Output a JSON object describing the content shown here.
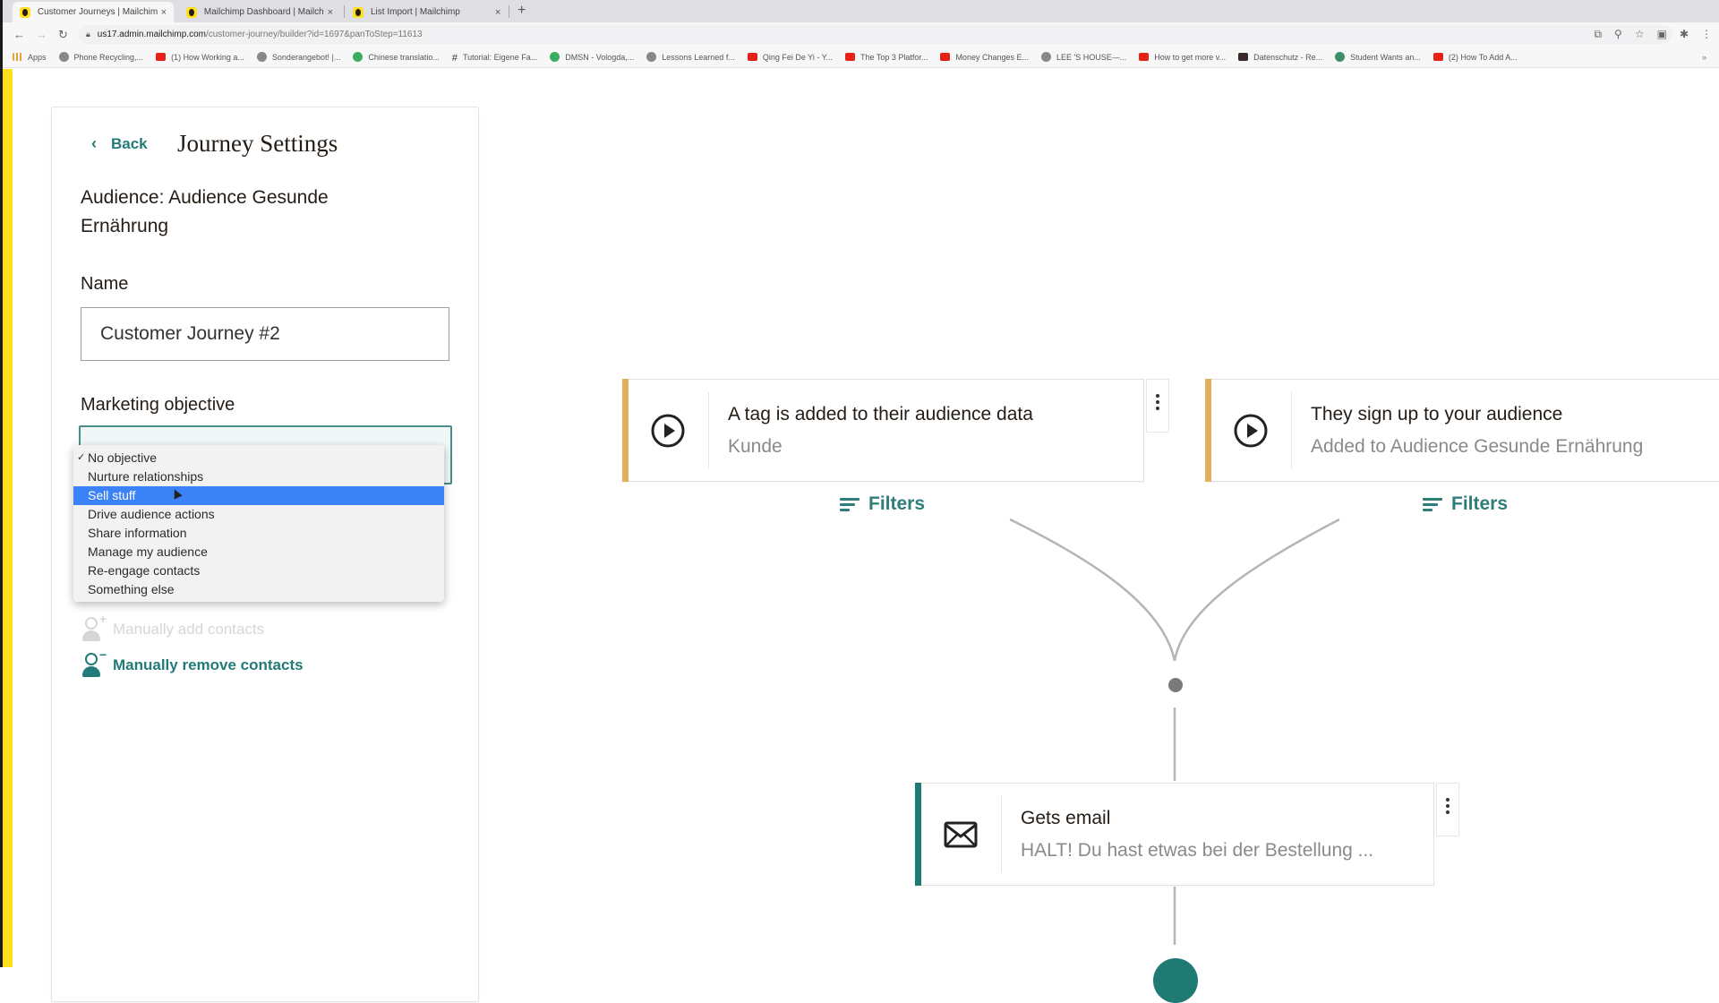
{
  "browser": {
    "tabs": [
      {
        "title": "Customer Journeys | Mailchimp",
        "active": true
      },
      {
        "title": "Mailchimp Dashboard | Mailchimp",
        "active": false
      },
      {
        "title": "List Import | Mailchimp",
        "active": false
      }
    ],
    "close_glyph": "×",
    "new_tab_glyph": "+",
    "url_host": "us17.admin.mailchimp.com",
    "url_path": "/customer-journey/builder?id=1697&panToStep=11613",
    "bookmarks": [
      {
        "label": "Apps",
        "icon": "apps-grid-icon"
      },
      {
        "label": "Phone Recycling,...",
        "icon": "o-icon"
      },
      {
        "label": "(1) How Working a...",
        "icon": "youtube-icon"
      },
      {
        "label": "Sonderangebot! |...",
        "icon": "globe-icon"
      },
      {
        "label": "Chinese translatio...",
        "icon": "green-circle-icon"
      },
      {
        "label": "Tutorial: Eigene Fa...",
        "icon": "hash-icon"
      },
      {
        "label": "DMSN - Vologda,...",
        "icon": "green-circle-icon"
      },
      {
        "label": "Lessons Learned f...",
        "icon": "figure-icon"
      },
      {
        "label": "Qing Fei De Yi - Y...",
        "icon": "youtube-icon"
      },
      {
        "label": "The Top 3 Platfor...",
        "icon": "youtube-icon"
      },
      {
        "label": "Money Changes E...",
        "icon": "youtube-icon"
      },
      {
        "label": "LEE 'S HOUSE—...",
        "icon": "airbnb-icon"
      },
      {
        "label": "How to get more v...",
        "icon": "youtube-icon"
      },
      {
        "label": "Datenschutz - Re...",
        "icon": "dark-square-icon"
      },
      {
        "label": "Student Wants an...",
        "icon": "teal-circle-icon"
      },
      {
        "label": "(2) How To Add A...",
        "icon": "youtube-icon"
      }
    ],
    "bookmarks_overflow": "»"
  },
  "panel": {
    "back_label": "Back",
    "title": "Journey Settings",
    "audience_text": "Audience: Audience Gesunde Ernährung",
    "name_label": "Name",
    "name_value": "Customer Journey #2",
    "objective_label": "Marketing objective",
    "objective_options": [
      {
        "label": "No objective",
        "checked": true,
        "highlighted": false
      },
      {
        "label": "Nurture relationships",
        "checked": false,
        "highlighted": false
      },
      {
        "label": "Sell stuff",
        "checked": false,
        "highlighted": true
      },
      {
        "label": "Drive audience actions",
        "checked": false,
        "highlighted": false
      },
      {
        "label": "Share information",
        "checked": false,
        "highlighted": false
      },
      {
        "label": "Manage my audience",
        "checked": false,
        "highlighted": false
      },
      {
        "label": "Re-engage contacts",
        "checked": false,
        "highlighted": false
      },
      {
        "label": "Something else",
        "checked": false,
        "highlighted": false
      }
    ],
    "check_glyph": "✓",
    "add_contacts_label": "Manually add contacts",
    "remove_contacts_label": "Manually remove contacts"
  },
  "journey": {
    "triggers": [
      {
        "title": "A tag is added to their audience data",
        "subtitle": "Kunde",
        "filters_label": "Filters"
      },
      {
        "title": "They sign up to your audience",
        "subtitle": "Added to Audience Gesunde Ernährung",
        "filters_label": "Filters"
      }
    ],
    "email_step": {
      "title": "Gets email",
      "subtitle": "HALT! Du hast etwas bei der Bestellung ..."
    }
  },
  "colors": {
    "brand_yellow": "#ffe01b",
    "teal": "#227b78",
    "trigger_accent": "#e0b05c",
    "action_accent": "#1f7a73",
    "highlight_blue": "#3b82f6"
  }
}
